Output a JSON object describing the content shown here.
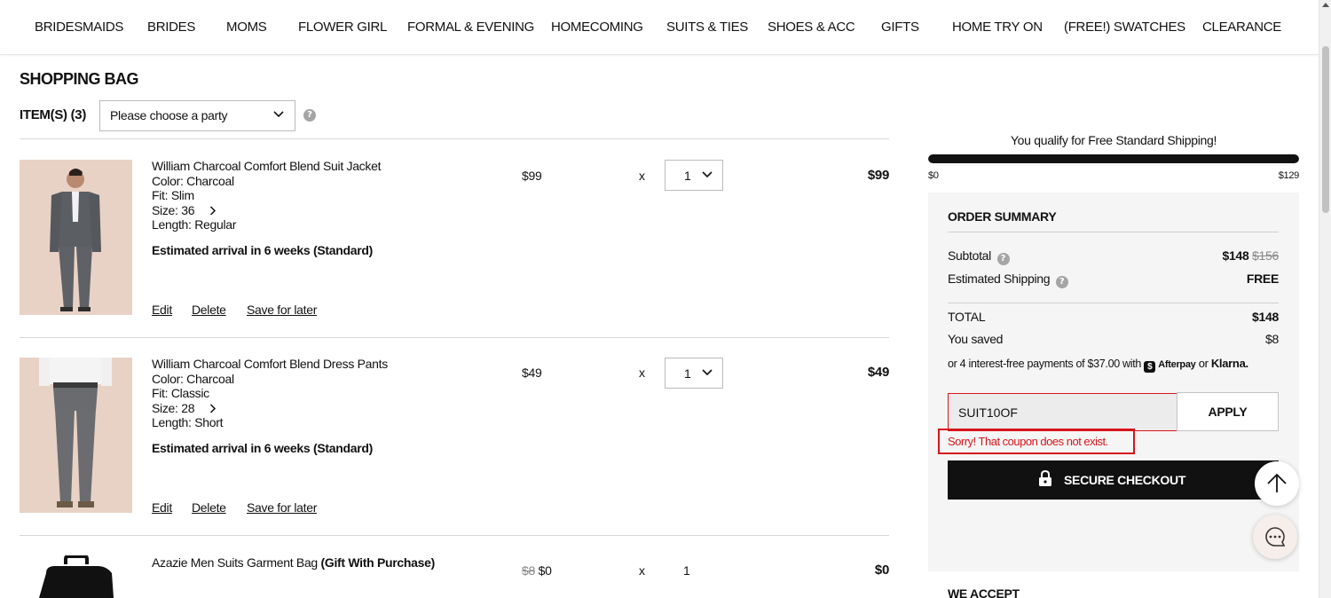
{
  "nav": [
    "BRIDESMAIDS",
    "BRIDES",
    "MOMS",
    "FLOWER GIRL",
    "FORMAL & EVENING",
    "HOMECOMING",
    "SUITS & TIES",
    "SHOES & ACC",
    "GIFTS",
    "HOME TRY ON",
    "(FREE!) SWATCHES",
    "CLEARANCE"
  ],
  "cart": {
    "title": "SHOPPING BAG",
    "items_count": "ITEM(S) (3)",
    "party_select": "Please choose a party",
    "help_icon": "?"
  },
  "items": [
    {
      "name": "William Charcoal Comfort Blend Suit Jacket",
      "color": "Color:  Charcoal",
      "fit": "Fit:  Slim",
      "size": "Size: 36",
      "length": "Length:  Regular",
      "arrival": "Estimated arrival in 6 weeks (Standard)",
      "price": "$99",
      "times": "x",
      "qty": "1",
      "total": "$99",
      "edit": "Edit",
      "delete": "Delete",
      "save": "Save for later"
    },
    {
      "name": "William Charcoal Comfort Blend Dress Pants",
      "color": "Color:  Charcoal",
      "fit": "Fit:  Classic",
      "size": "Size: 28",
      "length": "Length:  Short",
      "arrival": "Estimated arrival in 6 weeks (Standard)",
      "price": "$49",
      "times": "x",
      "qty": "1",
      "total": "$49",
      "edit": "Edit",
      "delete": "Delete",
      "save": "Save for later"
    },
    {
      "name": "Azazie Men Suits Garment Bag",
      "gift_tag": "(Gift With Purchase)",
      "old_price": "$8",
      "price": "$0",
      "times": "x",
      "qty": "1",
      "total": "$0"
    }
  ],
  "shipping": {
    "message": "You qualify for Free Standard Shipping!",
    "min_label": "$0",
    "max_label": "$129",
    "progress": 1.0
  },
  "summary": {
    "title": "ORDER SUMMARY",
    "subtotal_label": "Subtotal",
    "subtotal_value": "$148",
    "subtotal_original": "$156",
    "shipping_label": "Estimated Shipping",
    "shipping_value": "FREE",
    "total_label": "TOTAL",
    "total_value": "$148",
    "saved_label": "You saved",
    "saved_value": "$8",
    "installments_text": "or 4 interest-free payments of $37.00 with",
    "afterpay_badge": "$",
    "afterpay": "Afterpay",
    "or": "or",
    "klarna": "Klarna.",
    "coupon_value": "SUIT10OF",
    "apply_label": "APPLY",
    "coupon_error": "Sorry! That coupon does not exist.",
    "checkout_label": "SECURE CHECKOUT"
  },
  "we_accept": "WE ACCEPT",
  "colors": {
    "accent_black": "#111111",
    "error_red": "#d8141c",
    "panel_bg": "#f5f5f5"
  },
  "icons": [
    "chevron-down-icon",
    "help-icon",
    "chevron-right-icon",
    "lock-icon",
    "arrow-up-icon",
    "chat-icon"
  ]
}
